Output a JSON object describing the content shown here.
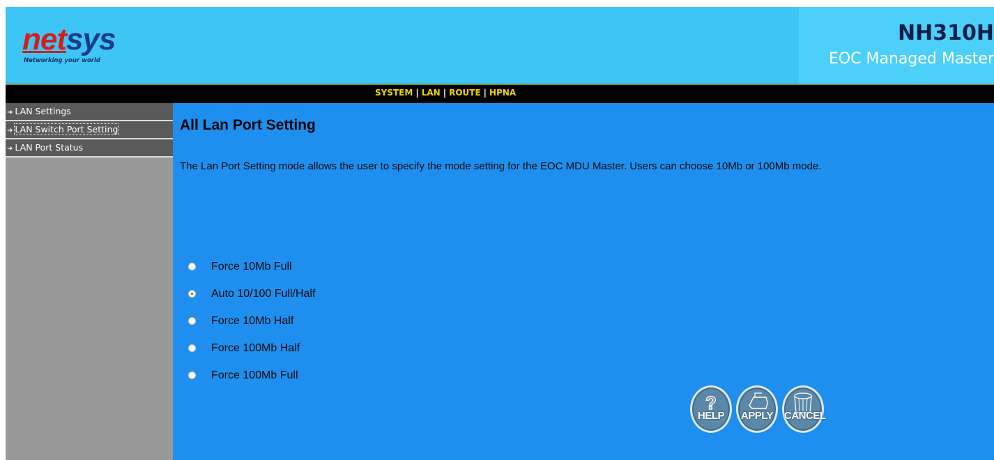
{
  "brand": {
    "logo_net": "net",
    "logo_sys": "sys",
    "tagline": "Networking your world"
  },
  "header": {
    "model": "NH310H",
    "subtitle": "EOC Managed Master"
  },
  "topnav": {
    "items": [
      "SYSTEM",
      "LAN",
      "ROUTE",
      "HPNA"
    ],
    "separator": "|"
  },
  "sidebar": {
    "items": [
      {
        "label": "LAN Settings",
        "selected": false
      },
      {
        "label": "LAN Switch Port Setting",
        "selected": true
      },
      {
        "label": "LAN Port Status",
        "selected": false
      }
    ]
  },
  "main": {
    "title": "All Lan Port Setting",
    "description": "The Lan Port Setting mode allows the user to specify the mode setting for the EOC MDU Master. Users can choose 10Mb or 100Mb mode.",
    "options": [
      {
        "label": "Force 10Mb Full",
        "checked": false
      },
      {
        "label": "Auto 10/100 Full/Half",
        "checked": true
      },
      {
        "label": "Force 10Mb Half",
        "checked": false
      },
      {
        "label": "Force 100Mb Half",
        "checked": false
      },
      {
        "label": "Force 100Mb Full",
        "checked": false
      }
    ],
    "buttons": {
      "help": "HELP",
      "apply": "APPLY",
      "cancel": "CANCEL"
    }
  },
  "colors": {
    "header_bg": "#3dc6f5",
    "content_bg": "#1e8fef",
    "sidebar_bg": "#999999",
    "nav_text": "#f2d200"
  }
}
